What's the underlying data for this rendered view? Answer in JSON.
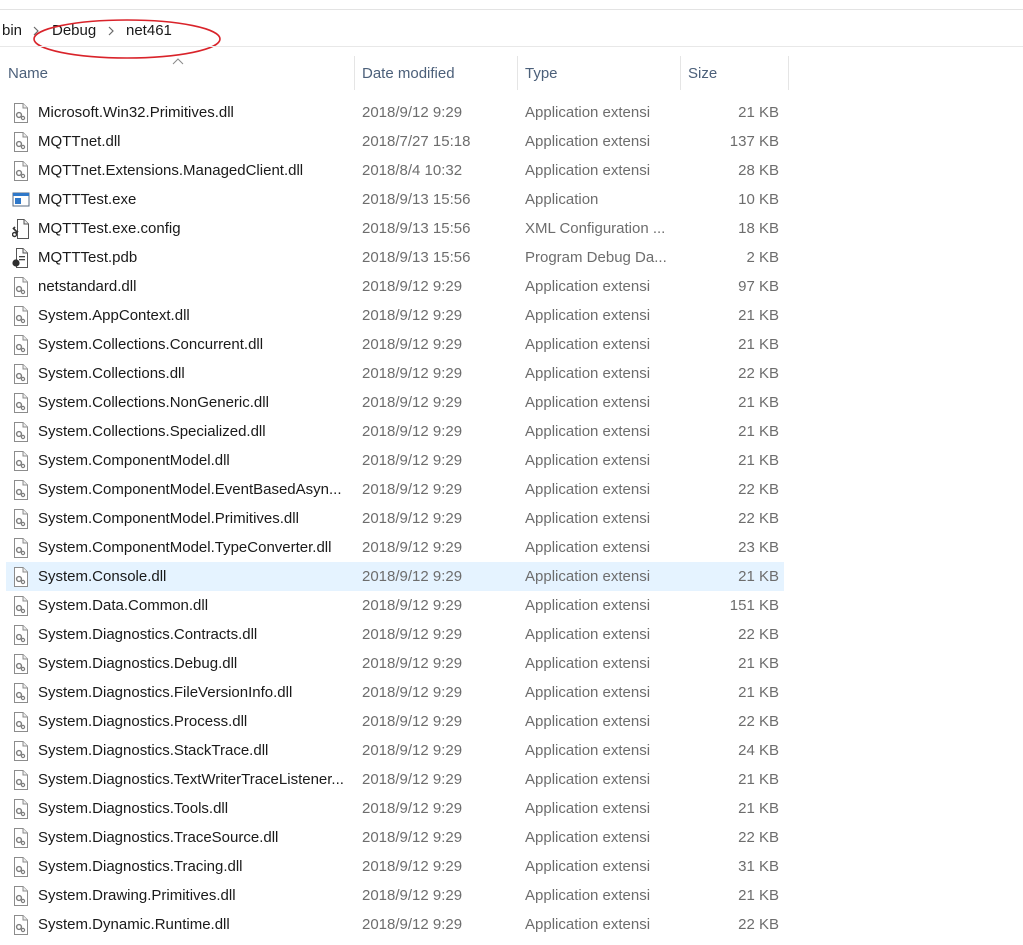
{
  "breadcrumb": {
    "items": [
      "bin",
      "Debug",
      "net461"
    ]
  },
  "columns": {
    "name": "Name",
    "date": "Date modified",
    "type": "Type",
    "size": "Size"
  },
  "colors": {
    "selected_row": "#e5f3ff",
    "header_text": "#4c607a",
    "annotation": "#d9232a"
  },
  "files": [
    {
      "name": "Microsoft.Win32.Primitives.dll",
      "date": "2018/9/12 9:29",
      "type": "Application extensi",
      "size": "21 KB",
      "icon": "dll-icon"
    },
    {
      "name": "MQTTnet.dll",
      "date": "2018/7/27 15:18",
      "type": "Application extensi",
      "size": "137 KB",
      "icon": "dll-icon"
    },
    {
      "name": "MQTTnet.Extensions.ManagedClient.dll",
      "date": "2018/8/4 10:32",
      "type": "Application extensi",
      "size": "28 KB",
      "icon": "dll-icon"
    },
    {
      "name": "MQTTTest.exe",
      "date": "2018/9/13 15:56",
      "type": "Application",
      "size": "10 KB",
      "icon": "exe-icon"
    },
    {
      "name": "MQTTTest.exe.config",
      "date": "2018/9/13 15:56",
      "type": "XML Configuration ...",
      "size": "18 KB",
      "icon": "config-icon"
    },
    {
      "name": "MQTTTest.pdb",
      "date": "2018/9/13 15:56",
      "type": "Program Debug Da...",
      "size": "2 KB",
      "icon": "pdb-icon"
    },
    {
      "name": "netstandard.dll",
      "date": "2018/9/12 9:29",
      "type": "Application extensi",
      "size": "97 KB",
      "icon": "dll-icon"
    },
    {
      "name": "System.AppContext.dll",
      "date": "2018/9/12 9:29",
      "type": "Application extensi",
      "size": "21 KB",
      "icon": "dll-icon"
    },
    {
      "name": "System.Collections.Concurrent.dll",
      "date": "2018/9/12 9:29",
      "type": "Application extensi",
      "size": "21 KB",
      "icon": "dll-icon"
    },
    {
      "name": "System.Collections.dll",
      "date": "2018/9/12 9:29",
      "type": "Application extensi",
      "size": "22 KB",
      "icon": "dll-icon"
    },
    {
      "name": "System.Collections.NonGeneric.dll",
      "date": "2018/9/12 9:29",
      "type": "Application extensi",
      "size": "21 KB",
      "icon": "dll-icon"
    },
    {
      "name": "System.Collections.Specialized.dll",
      "date": "2018/9/12 9:29",
      "type": "Application extensi",
      "size": "21 KB",
      "icon": "dll-icon"
    },
    {
      "name": "System.ComponentModel.dll",
      "date": "2018/9/12 9:29",
      "type": "Application extensi",
      "size": "21 KB",
      "icon": "dll-icon"
    },
    {
      "name": "System.ComponentModel.EventBasedAsyn...",
      "date": "2018/9/12 9:29",
      "type": "Application extensi",
      "size": "22 KB",
      "icon": "dll-icon"
    },
    {
      "name": "System.ComponentModel.Primitives.dll",
      "date": "2018/9/12 9:29",
      "type": "Application extensi",
      "size": "22 KB",
      "icon": "dll-icon"
    },
    {
      "name": "System.ComponentModel.TypeConverter.dll",
      "date": "2018/9/12 9:29",
      "type": "Application extensi",
      "size": "23 KB",
      "icon": "dll-icon"
    },
    {
      "name": "System.Console.dll",
      "date": "2018/9/12 9:29",
      "type": "Application extensi",
      "size": "21 KB",
      "icon": "dll-icon",
      "selected": true
    },
    {
      "name": "System.Data.Common.dll",
      "date": "2018/9/12 9:29",
      "type": "Application extensi",
      "size": "151 KB",
      "icon": "dll-icon"
    },
    {
      "name": "System.Diagnostics.Contracts.dll",
      "date": "2018/9/12 9:29",
      "type": "Application extensi",
      "size": "22 KB",
      "icon": "dll-icon"
    },
    {
      "name": "System.Diagnostics.Debug.dll",
      "date": "2018/9/12 9:29",
      "type": "Application extensi",
      "size": "21 KB",
      "icon": "dll-icon"
    },
    {
      "name": "System.Diagnostics.FileVersionInfo.dll",
      "date": "2018/9/12 9:29",
      "type": "Application extensi",
      "size": "21 KB",
      "icon": "dll-icon"
    },
    {
      "name": "System.Diagnostics.Process.dll",
      "date": "2018/9/12 9:29",
      "type": "Application extensi",
      "size": "22 KB",
      "icon": "dll-icon"
    },
    {
      "name": "System.Diagnostics.StackTrace.dll",
      "date": "2018/9/12 9:29",
      "type": "Application extensi",
      "size": "24 KB",
      "icon": "dll-icon"
    },
    {
      "name": "System.Diagnostics.TextWriterTraceListener...",
      "date": "2018/9/12 9:29",
      "type": "Application extensi",
      "size": "21 KB",
      "icon": "dll-icon"
    },
    {
      "name": "System.Diagnostics.Tools.dll",
      "date": "2018/9/12 9:29",
      "type": "Application extensi",
      "size": "21 KB",
      "icon": "dll-icon"
    },
    {
      "name": "System.Diagnostics.TraceSource.dll",
      "date": "2018/9/12 9:29",
      "type": "Application extensi",
      "size": "22 KB",
      "icon": "dll-icon"
    },
    {
      "name": "System.Diagnostics.Tracing.dll",
      "date": "2018/9/12 9:29",
      "type": "Application extensi",
      "size": "31 KB",
      "icon": "dll-icon"
    },
    {
      "name": "System.Drawing.Primitives.dll",
      "date": "2018/9/12 9:29",
      "type": "Application extensi",
      "size": "21 KB",
      "icon": "dll-icon"
    },
    {
      "name": "System.Dynamic.Runtime.dll",
      "date": "2018/9/12 9:29",
      "type": "Application extensi",
      "size": "22 KB",
      "icon": "dll-icon"
    }
  ]
}
